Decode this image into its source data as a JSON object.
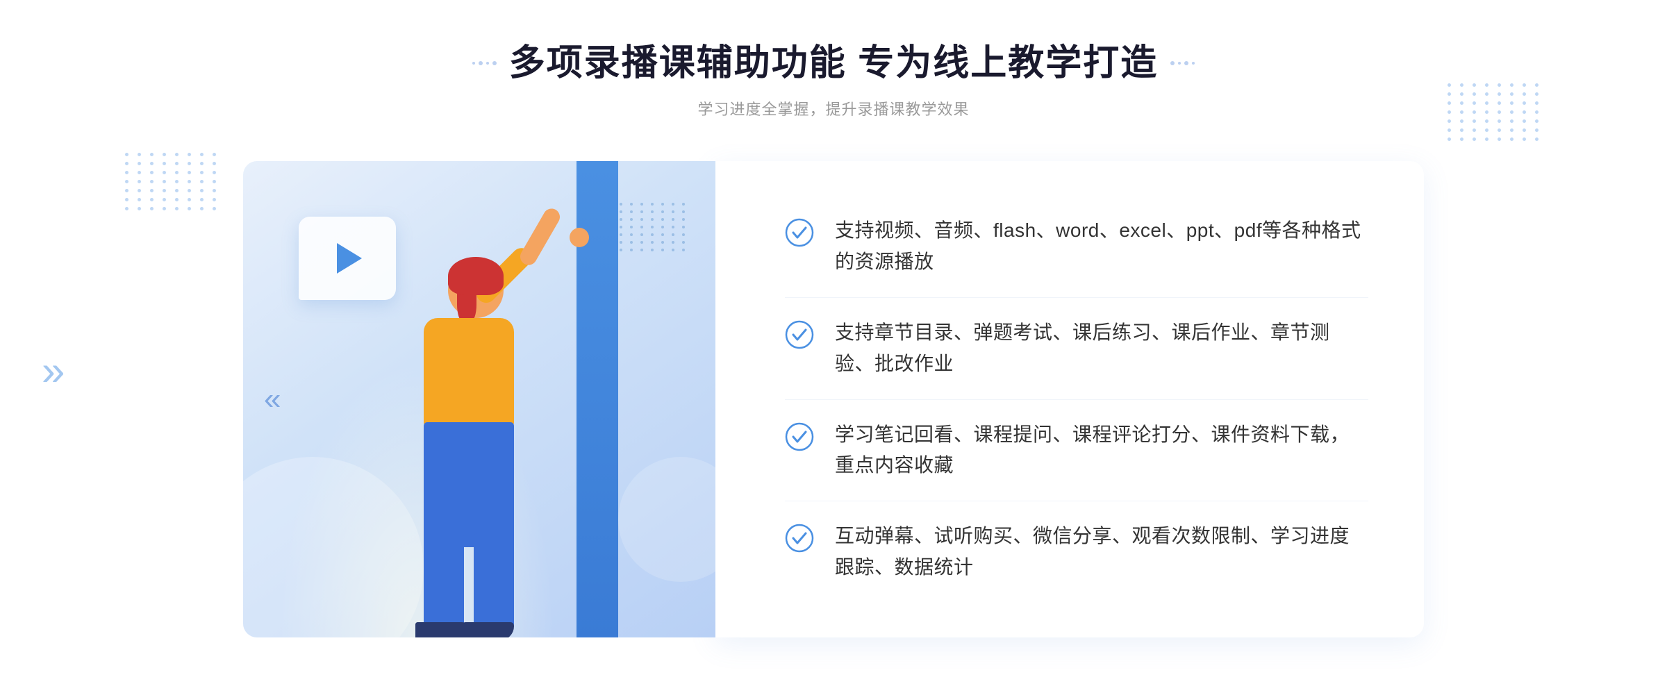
{
  "header": {
    "main_title": "多项录播课辅助功能 专为线上教学打造",
    "sub_title": "学习进度全掌握，提升录播课教学效果"
  },
  "features": [
    {
      "id": "feature-1",
      "text": "支持视频、音频、flash、word、excel、ppt、pdf等各种格式的资源播放"
    },
    {
      "id": "feature-2",
      "text": "支持章节目录、弹题考试、课后练习、课后作业、章节测验、批改作业"
    },
    {
      "id": "feature-3",
      "text": "学习笔记回看、课程提问、课程评论打分、课件资料下载，重点内容收藏"
    },
    {
      "id": "feature-4",
      "text": "互动弹幕、试听购买、微信分享、观看次数限制、学习进度跟踪、数据统计"
    }
  ],
  "icons": {
    "check": "check-circle-icon",
    "play": "play-icon",
    "chevron": "chevron-right-icon"
  },
  "colors": {
    "primary": "#4a90e2",
    "title": "#1a1a2e",
    "text": "#333333",
    "subtitle": "#999999",
    "bg_gradient_start": "#e8f0fb",
    "bg_gradient_end": "#b8d0f5",
    "accent_bar": "#3a7bd5"
  }
}
